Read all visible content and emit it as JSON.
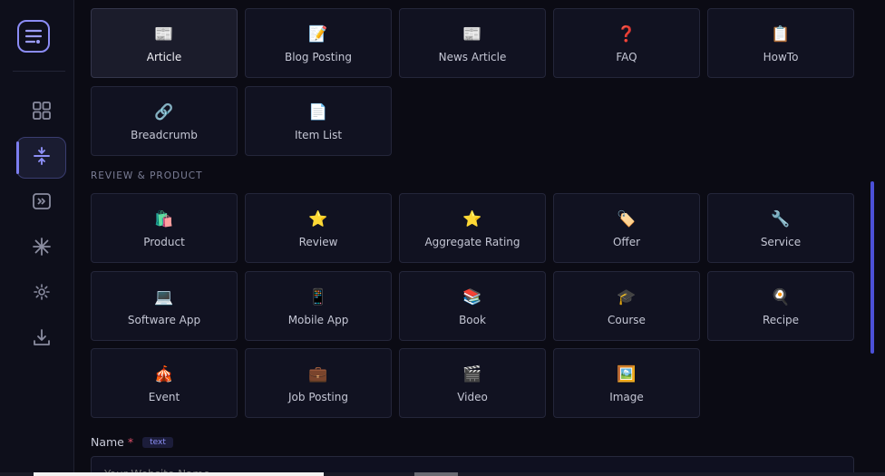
{
  "rail": {
    "logo_icon": "menu-lines-icon",
    "items": [
      {
        "icon": "grid-icon",
        "active": false
      },
      {
        "icon": "vertical-split-icon",
        "active": true
      },
      {
        "icon": "fast-forward-box-icon",
        "active": false
      },
      {
        "icon": "sparkle-asterisk-icon",
        "active": false
      },
      {
        "icon": "sun-gear-icon",
        "active": false
      },
      {
        "icon": "download-icon",
        "active": false
      }
    ]
  },
  "general_cards": [
    {
      "emoji": "📰",
      "label": "Article",
      "selected": true
    },
    {
      "emoji": "📝",
      "label": "Blog Posting",
      "selected": false
    },
    {
      "emoji": "📰",
      "label": "News Article",
      "selected": false
    },
    {
      "emoji": "❓",
      "label": "FAQ",
      "selected": false
    },
    {
      "emoji": "📋",
      "label": "HowTo",
      "selected": false
    },
    {
      "emoji": "🔗",
      "label": "Breadcrumb",
      "selected": false
    },
    {
      "emoji": "📄",
      "label": "Item List",
      "selected": false
    }
  ],
  "section_review": {
    "title": "REVIEW & PRODUCT"
  },
  "review_cards": [
    {
      "emoji": "🛍️",
      "label": "Product"
    },
    {
      "emoji": "⭐",
      "label": "Review"
    },
    {
      "emoji": "⭐",
      "label": "Aggregate Rating"
    },
    {
      "emoji": "🏷️",
      "label": "Offer"
    },
    {
      "emoji": "🔧",
      "label": "Service"
    },
    {
      "emoji": "💻",
      "label": "Software App"
    },
    {
      "emoji": "📱",
      "label": "Mobile App"
    },
    {
      "emoji": "📚",
      "label": "Book"
    },
    {
      "emoji": "🎓",
      "label": "Course"
    },
    {
      "emoji": "🍳",
      "label": "Recipe"
    },
    {
      "emoji": "🎪",
      "label": "Event"
    },
    {
      "emoji": "💼",
      "label": "Job Posting"
    },
    {
      "emoji": "🎬",
      "label": "Video"
    },
    {
      "emoji": "🖼️",
      "label": "Image"
    }
  ],
  "name_field": {
    "label": "Name",
    "required_mark": "*",
    "type_badge": "text",
    "placeholder": "Your Website Name"
  },
  "colors": {
    "accent": "#7c7ef0",
    "required": "#e0506a",
    "scroll_thumb": "#4b50d8"
  }
}
